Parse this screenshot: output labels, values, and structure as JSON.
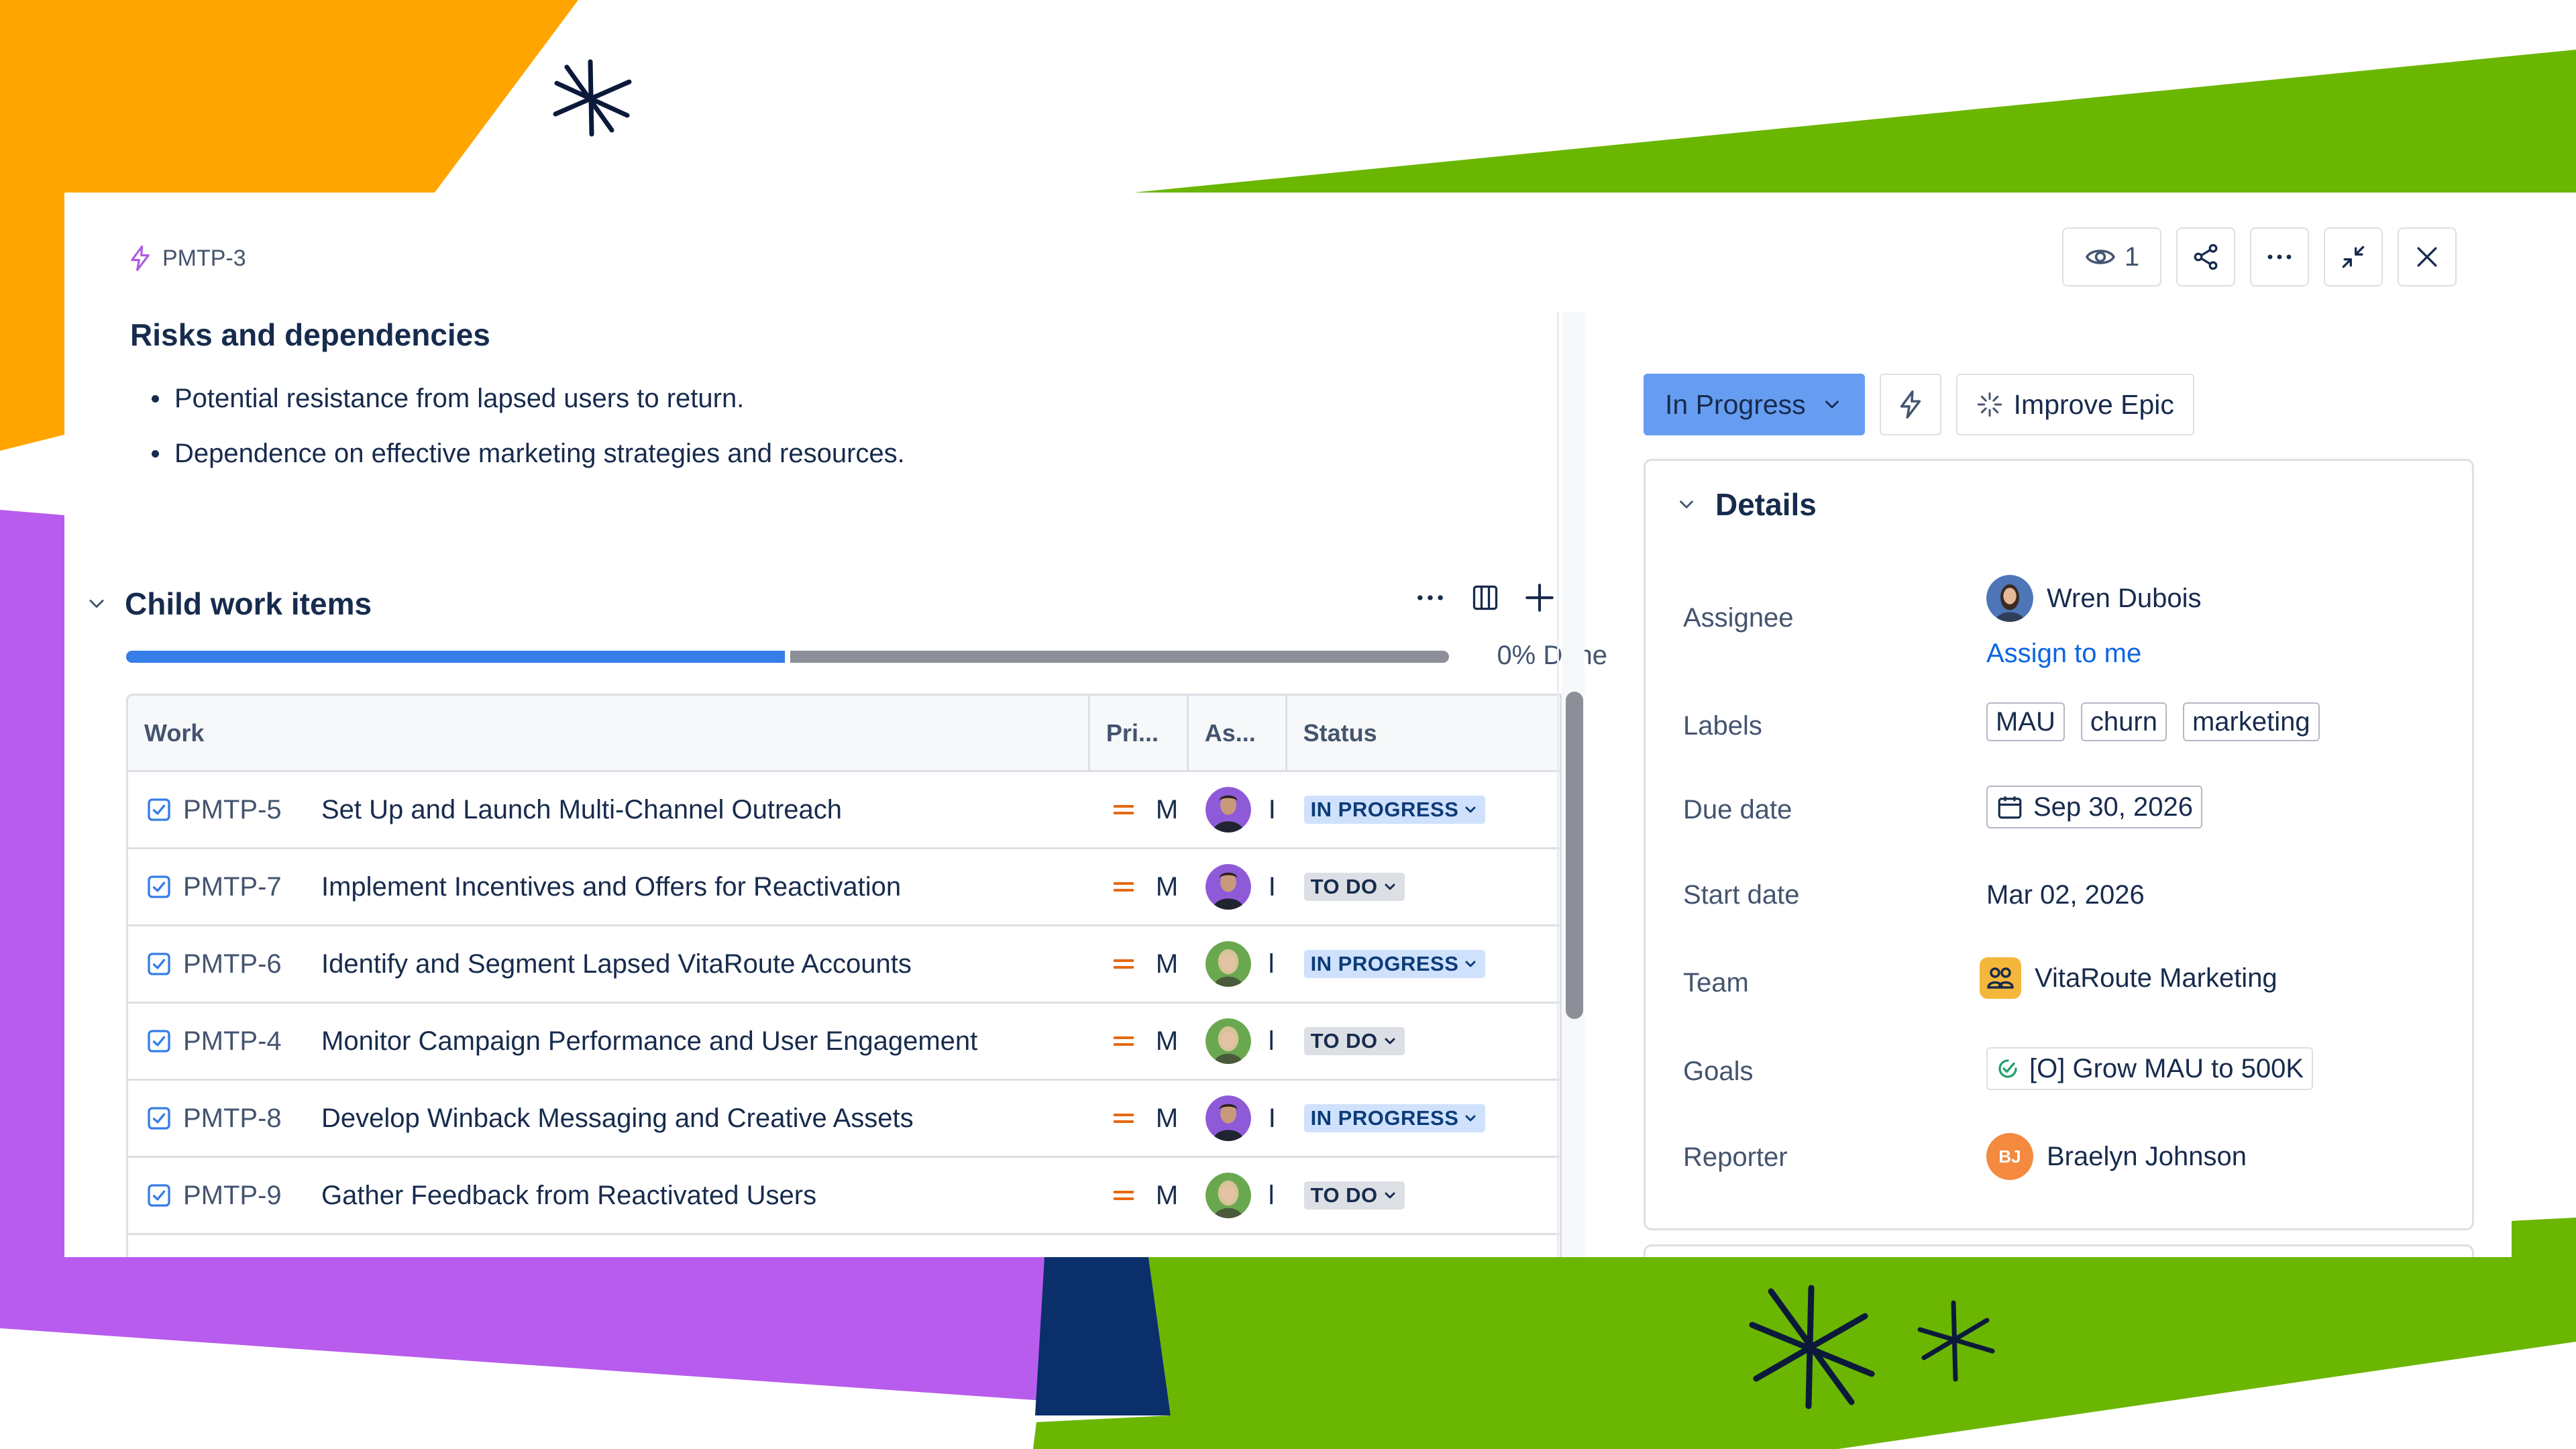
{
  "issue": {
    "key": "PMTP-3"
  },
  "header": {
    "watch_count": "1"
  },
  "description": {
    "heading": "Risks and dependencies",
    "bullets": [
      "Potential resistance from lapsed users to return.",
      "Dependence on effective marketing strategies and resources."
    ]
  },
  "child_items": {
    "title": "Child work items",
    "progress_percent": 0,
    "progress_label": "0% Done",
    "columns": {
      "work": "Work",
      "priority": "Pri...",
      "assignee": "As...",
      "status": "Status"
    },
    "rows": [
      {
        "key": "PMTP-5",
        "summary": "Set Up and Launch Multi-Channel Outreach",
        "priority": "M",
        "assignee_initial": "I",
        "status": "IN PROGRESS"
      },
      {
        "key": "PMTP-7",
        "summary": "Implement Incentives and Offers for Reactivation",
        "priority": "M",
        "assignee_initial": "I",
        "status": "TO DO"
      },
      {
        "key": "PMTP-6",
        "summary": "Identify and Segment Lapsed VitaRoute Accounts",
        "priority": "M",
        "assignee_initial": "l",
        "status": "IN PROGRESS"
      },
      {
        "key": "PMTP-4",
        "summary": "Monitor Campaign Performance and User Engagement",
        "priority": "M",
        "assignee_initial": "l",
        "status": "TO DO"
      },
      {
        "key": "PMTP-8",
        "summary": "Develop Winback Messaging and Creative Assets",
        "priority": "M",
        "assignee_initial": "I",
        "status": "IN PROGRESS"
      },
      {
        "key": "PMTP-9",
        "summary": "Gather Feedback from Reactivated Users",
        "priority": "M",
        "assignee_initial": "l",
        "status": "TO DO"
      }
    ]
  },
  "sidebar": {
    "status": "In Progress",
    "improve_label": "Improve Epic",
    "details_title": "Details",
    "assignee_label": "Assignee",
    "assignee_name": "Wren Dubois",
    "assign_to_me": "Assign to me",
    "labels_label": "Labels",
    "labels": [
      "MAU",
      "churn",
      "marketing"
    ],
    "due_label": "Due date",
    "due_value": "Sep 30, 2026",
    "start_label": "Start date",
    "start_value": "Mar 02, 2026",
    "team_label": "Team",
    "team_value": "VitaRoute Marketing",
    "goals_label": "Goals",
    "goals_value": "[O] Grow MAU to 500K",
    "reporter_label": "Reporter",
    "reporter_initials": "BJ",
    "reporter_name": "Braelyn Johnson"
  },
  "colors": {
    "accent_orange": "#FFA500",
    "accent_green": "#6BB600",
    "accent_purple": "#B75CED",
    "accent_navy": "#0A2F6B",
    "status_blue": "#669DF1",
    "progress_blue": "#357DE8"
  },
  "icons": [
    "epic-icon",
    "eye-icon",
    "share-icon",
    "more-icon",
    "minimize-icon",
    "close-icon",
    "chevron-down-icon",
    "columns-icon",
    "plus-icon",
    "checkbox-icon",
    "priority-medium-icon",
    "lightning-icon",
    "sparkle-icon",
    "calendar-icon",
    "team-icon",
    "goal-icon"
  ]
}
